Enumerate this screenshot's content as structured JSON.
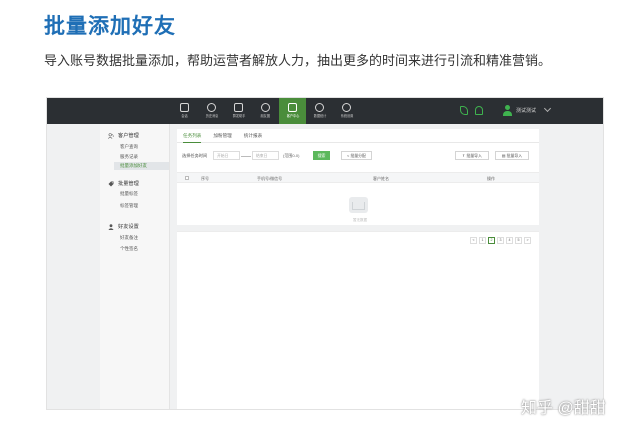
{
  "heading": "批量添加好友",
  "description": "导入账号数据批量添加，帮助运营者解放人力，抽出更多的时间来进行引流和精准营销。",
  "watermark": "知乎 @甜甜",
  "colors": {
    "heading": "#1f6fb6",
    "topbar": "#2b2f33",
    "accent": "#4a8d3b",
    "primary_button": "#5cb85c"
  },
  "app": {
    "topnav": [
      {
        "icon": "chat-icon",
        "label": "会话"
      },
      {
        "icon": "clock-icon",
        "label": "历史消息"
      },
      {
        "icon": "send-icon",
        "label": "群发助手"
      },
      {
        "icon": "globe-icon",
        "label": "朋友圈"
      },
      {
        "icon": "user-add-icon",
        "label": "客户中心",
        "active": true
      },
      {
        "icon": "chart-icon",
        "label": "数据统计"
      },
      {
        "icon": "gear-icon",
        "label": "系统设置"
      }
    ],
    "user_name": "测试测试",
    "sidebar": {
      "groups": [
        {
          "icon": "users-icon",
          "title": "客户管理",
          "items": [
            "客户查询",
            "服务记录",
            "批量添加好友"
          ]
        },
        {
          "icon": "tag-icon",
          "title": "批量管理",
          "items": [
            "批量标签",
            "标签管理"
          ]
        },
        {
          "icon": "person-icon",
          "title": "好友设置",
          "items": [
            "好友备注",
            "个性签名"
          ]
        }
      ],
      "active_item": "批量添加好友"
    },
    "tabs": [
      "任务列表",
      "加粉管理",
      "统计报表"
    ],
    "active_tab": "任务列表",
    "filter": {
      "label": "选择任务时间",
      "start_placeholder": "开始日",
      "end_placeholder": "结束日",
      "hint": "(范围0-0)",
      "search_label": "搜索",
      "reset_label": "< 批量分配",
      "import_label": "批量导入",
      "export_label": "批量导入"
    },
    "table": {
      "columns": [
        "序号",
        "手机号/微信号",
        "客户姓名",
        "操作"
      ]
    },
    "empty_text": "暂无数据",
    "pager": [
      "<",
      "1",
      "2",
      "3",
      "4",
      "5",
      ">"
    ],
    "pager_active": "2"
  }
}
